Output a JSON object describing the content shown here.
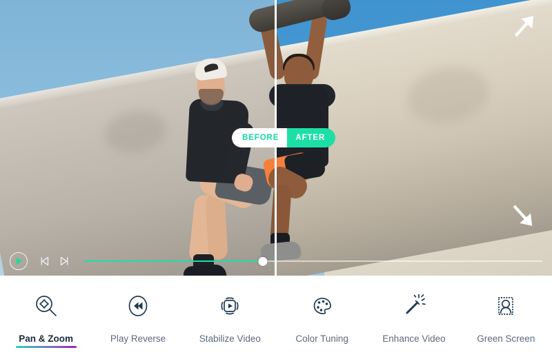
{
  "preview": {
    "compare": {
      "before_label": "BEFORE",
      "after_label": "AFTER",
      "before_color": "#14d9a0",
      "after_bg": "#1ddfa6"
    },
    "handles": {
      "top_right": "arrow-up-right",
      "bottom_right": "arrow-down-right"
    }
  },
  "player": {
    "play_label": "Play",
    "prev_label": "Previous frame",
    "next_label": "Next frame",
    "progress_percent": 39,
    "accent_color": "#1ddfa6"
  },
  "toolbar": {
    "active_index": 0,
    "active_underline_gradient": [
      "#2ed3b0",
      "#a21ecb"
    ],
    "items": [
      {
        "label": "Pan & Zoom",
        "icon": "pan-zoom-icon"
      },
      {
        "label": "Play Reverse",
        "icon": "play-reverse-icon"
      },
      {
        "label": "Stabilize Video",
        "icon": "stabilize-video-icon"
      },
      {
        "label": "Color Tuning",
        "icon": "color-palette-icon"
      },
      {
        "label": "Enhance Video",
        "icon": "magic-wand-icon"
      },
      {
        "label": "Green Screen",
        "icon": "person-cutout-icon"
      }
    ]
  }
}
